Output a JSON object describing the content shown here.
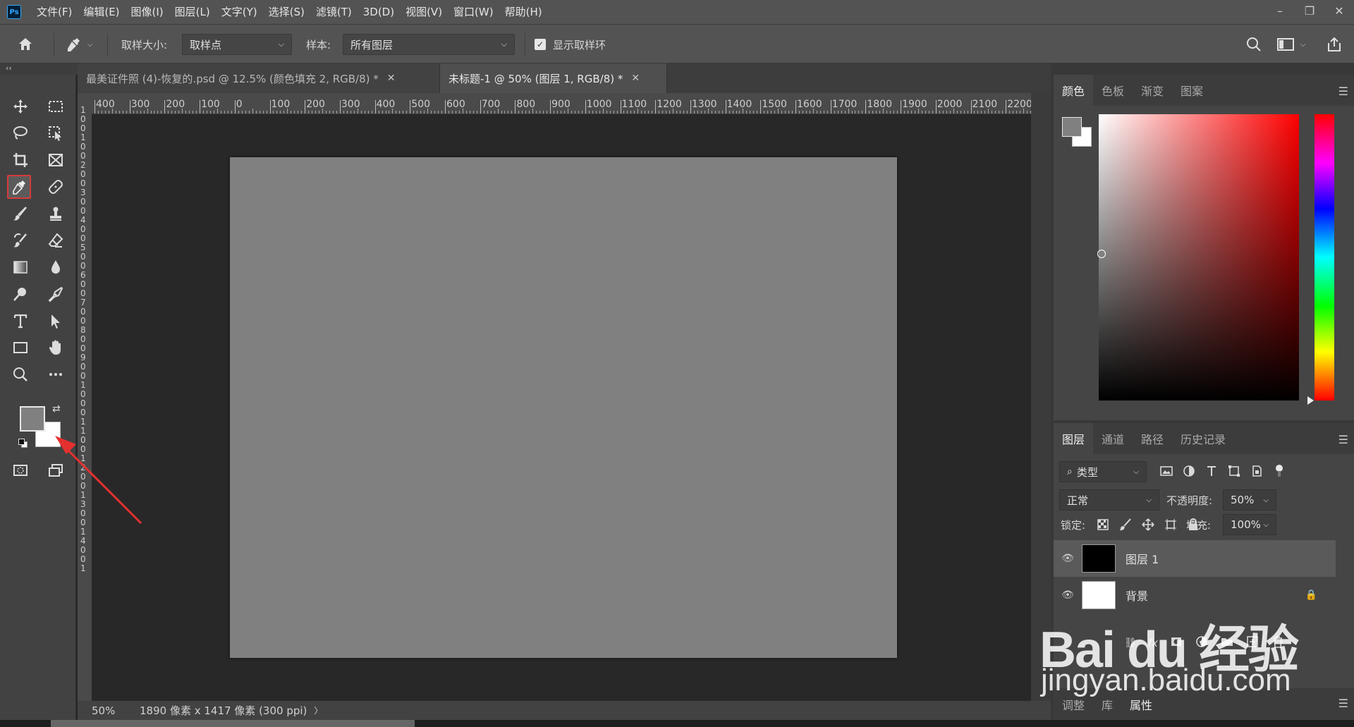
{
  "app": {
    "logo_text": "Ps"
  },
  "menu": [
    "文件(F)",
    "编辑(E)",
    "图像(I)",
    "图层(L)",
    "文字(Y)",
    "选择(S)",
    "滤镜(T)",
    "3D(D)",
    "视图(V)",
    "窗口(W)",
    "帮助(H)"
  ],
  "options": {
    "sample_size_label": "取样大小:",
    "sample_size_value": "取样点",
    "sample_label": "样本:",
    "sample_value": "所有图层",
    "show_ring_label": "显示取样环",
    "show_ring_checked": true
  },
  "tabs": [
    {
      "title": "最美证件照 (4)-恢复的.psd @ 12.5% (颜色填充 2, RGB/8) *",
      "active": false
    },
    {
      "title": "未标题-1 @ 50% (图层 1, RGB/8) *",
      "active": true
    }
  ],
  "ruler_h_labels": [
    "400",
    "300",
    "200",
    "100",
    "0",
    "100",
    "200",
    "300",
    "400",
    "500",
    "600",
    "700",
    "800",
    "900",
    "1000",
    "1100",
    "1200",
    "1300",
    "1400",
    "1500",
    "1600",
    "1700",
    "1800",
    "1900",
    "2000",
    "2100",
    "2200"
  ],
  "ruler_v_text": "100 100 200 300 400 500 600 700 800 900 1000 1100 1200 1300 1400 1",
  "status": {
    "zoom": "50%",
    "doc_info": "1890 像素 x 1417 像素 (300 ppi)"
  },
  "colors": {
    "foreground": "#808080",
    "background": "#ffffff",
    "canvas": "#808080",
    "selected_tool_outline": "#d63b3b"
  },
  "color_panel": {
    "tabs": [
      "颜色",
      "色板",
      "渐变",
      "图案"
    ],
    "active": "颜色"
  },
  "layers_panel": {
    "tabs": [
      "图层",
      "通道",
      "路径",
      "历史记录"
    ],
    "active": "图层",
    "filter_label": "类型",
    "blend_mode": "正常",
    "opacity_label": "不透明度:",
    "opacity_value": "50%",
    "lock_label": "锁定:",
    "fill_label": "填充:",
    "fill_value": "100%",
    "layers": [
      {
        "name": "图层 1",
        "thumb": "#000000",
        "selected": true
      },
      {
        "name": "背景",
        "thumb": "#ffffff",
        "locked": true
      }
    ]
  },
  "bottom_panel": {
    "tabs": [
      "调整",
      "库",
      "属性"
    ],
    "active": "属性"
  },
  "watermark": {
    "line1": "Bai du 经验",
    "line2": "jingyan.baidu.com"
  }
}
